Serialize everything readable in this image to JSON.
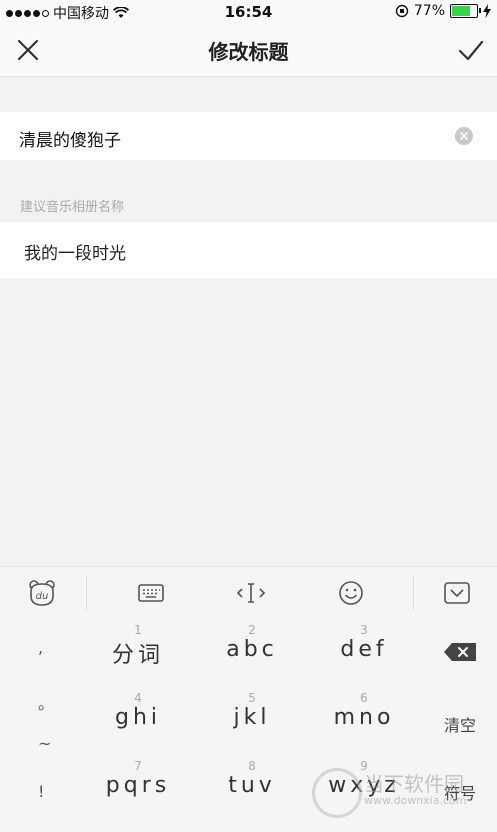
{
  "status_bar": {
    "carrier": "中国移动",
    "time": "16:54",
    "battery_percent": "77%",
    "battery_level": 0.77
  },
  "nav": {
    "title": "修改标题",
    "close_icon": "close-icon",
    "done_icon": "checkmark-icon"
  },
  "title_field": {
    "value": "清晨的傻狍子"
  },
  "suggestions": {
    "label": "建议音乐相册名称",
    "items": [
      "我的一段时光"
    ]
  },
  "keyboard": {
    "toolbar_icons": [
      "du-logo-icon",
      "keyboard-icon",
      "cursor-icon",
      "emoji-icon",
      "collapse-keyboard-icon"
    ],
    "punct": [
      ",",
      "。",
      "~",
      "!"
    ],
    "rows": [
      [
        {
          "num": "1",
          "letters": "分词"
        },
        {
          "num": "2",
          "letters": "abc"
        },
        {
          "num": "3",
          "letters": "def"
        }
      ],
      [
        {
          "num": "4",
          "letters": "ghi"
        },
        {
          "num": "5",
          "letters": "jkl"
        },
        {
          "num": "6",
          "letters": "mno"
        }
      ],
      [
        {
          "num": "7",
          "letters": "pqrs"
        },
        {
          "num": "8",
          "letters": "tuv"
        },
        {
          "num": "9",
          "letters": "wxyz"
        }
      ]
    ],
    "clear_label": "清空",
    "symbol_label": "符号"
  },
  "watermark": {
    "text": "当下软件园",
    "url": "www.downxia.com"
  },
  "colors": {
    "battery_green": "#3bd34b",
    "background": "#f2f2f2"
  }
}
